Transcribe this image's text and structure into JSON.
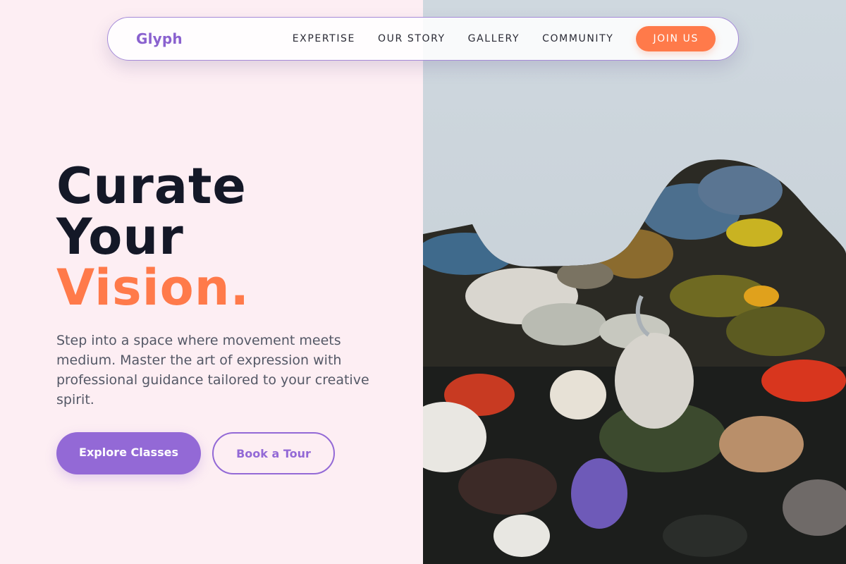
{
  "brand": {
    "name": "Glyph"
  },
  "nav": {
    "links": [
      "EXPERTISE",
      "OUR STORY",
      "GALLERY",
      "COMMUNITY"
    ],
    "cta_label": "JOIN US"
  },
  "hero": {
    "headline_line1": "Curate",
    "headline_line2": "Your",
    "headline_line3": "Vision.",
    "lead": "Step into a space where movement meets medium. Master the art of expression with professional guidance tailored to your creative spirit.",
    "primary_cta": "Explore Classes",
    "secondary_cta": "Book a Tour"
  },
  "image": {
    "description_icon": "paint-palette-image"
  },
  "colors": {
    "accent_orange": "#ff7a4a",
    "accent_purple": "#9369d6",
    "background_pink": "#fdeef3",
    "headline_dark": "#141827"
  }
}
